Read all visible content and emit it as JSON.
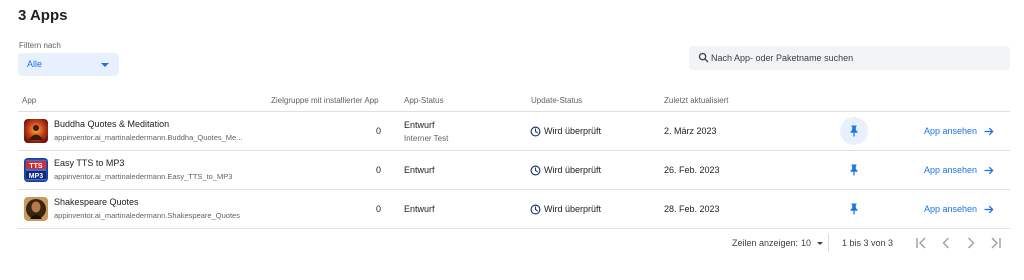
{
  "page": {
    "title": "3 Apps"
  },
  "filter": {
    "label": "Filtern nach",
    "value": "Alle"
  },
  "search": {
    "placeholder": "Nach App- oder Paketname suchen"
  },
  "table": {
    "headers": {
      "app": "App",
      "audience": "Zielgruppe mit installierter App",
      "app_status": "App-Status",
      "update_status": "Update-Status",
      "last_updated": "Zuletzt aktualisiert"
    },
    "rows": [
      {
        "name": "Buddha Quotes & Meditation",
        "package": "appinventor.ai_martinaledermann.Buddha_Quotes_Me...",
        "audience": "0",
        "status": "Entwurf",
        "status_sub": "Interner Test",
        "update_status": "Wird überprüft",
        "date": "2. März 2023",
        "link": "App ansehen",
        "icon": "buddha-app-icon",
        "pinned_highlight": true
      },
      {
        "name": "Easy TTS to MP3",
        "package": "appinventor.ai_martinaledermann.Easy_TTS_to_MP3",
        "audience": "0",
        "status": "Entwurf",
        "status_sub": "",
        "update_status": "Wird überprüft",
        "date": "26. Feb. 2023",
        "link": "App ansehen",
        "icon": "tts-mp3-app-icon",
        "icon_text_top": "TTS",
        "icon_text_bottom": "MP3"
      },
      {
        "name": "Shakespeare Quotes",
        "package": "appinventor.ai_martinaledermann.Shakespeare_Quotes",
        "audience": "0",
        "status": "Entwurf",
        "status_sub": "",
        "update_status": "Wird überprüft",
        "date": "28. Feb. 2023",
        "link": "App ansehen",
        "icon": "shakespeare-app-icon"
      }
    ]
  },
  "pagination": {
    "rows_label": "Zeilen anzeigen:",
    "rows_value": "10",
    "range": "1 bis 3 von 3"
  },
  "colors": {
    "accent": "#1a73e8",
    "accent_bg": "#e8f0fe",
    "divider": "#e0e0e0"
  }
}
